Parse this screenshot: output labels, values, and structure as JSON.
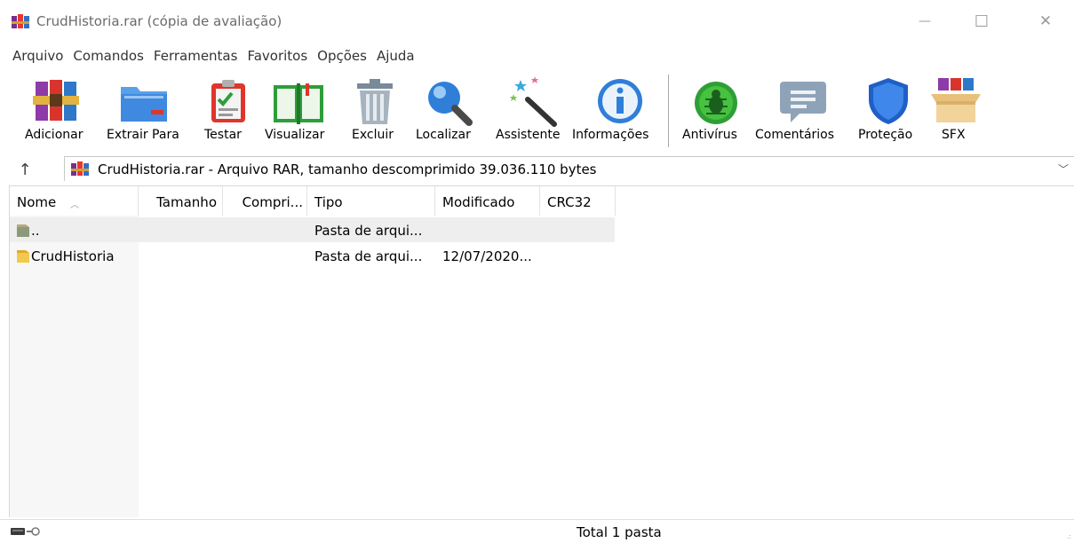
{
  "window": {
    "title": "CrudHistoria.rar (cópia de avaliação)",
    "minimize_glyph": "—",
    "maximize_glyph": "☐",
    "close_glyph": "✕"
  },
  "menu": [
    "Arquivo",
    "Comandos",
    "Ferramentas",
    "Favoritos",
    "Opções",
    "Ajuda"
  ],
  "toolbar": {
    "items": [
      {
        "label": "Adicionar",
        "icon": "books-add-icon"
      },
      {
        "label": "Extrair Para",
        "icon": "folder-extract-icon"
      },
      {
        "label": "Testar",
        "icon": "clipboard-check-icon"
      },
      {
        "label": "Visualizar",
        "icon": "open-book-icon"
      },
      {
        "label": "Excluir",
        "icon": "trash-icon"
      },
      {
        "label": "Localizar",
        "icon": "magnifier-icon"
      },
      {
        "label": "Assistente",
        "icon": "magic-wand-icon"
      },
      {
        "label": "Informações",
        "icon": "info-icon"
      },
      {
        "label": "Antivírus",
        "icon": "bug-icon"
      },
      {
        "label": "Comentários",
        "icon": "comment-icon"
      },
      {
        "label": "Proteção",
        "icon": "shield-icon"
      },
      {
        "label": "SFX",
        "icon": "sfx-box-icon"
      }
    ]
  },
  "address": {
    "up_glyph": "↑",
    "text": "CrudHistoria.rar - Arquivo RAR, tamanho descomprimido 39.036.110 bytes",
    "dropdown_glyph": "﹀"
  },
  "columns": [
    "Nome",
    "Tamanho",
    "Compri...",
    "Tipo",
    "Modificado",
    "CRC32"
  ],
  "rows": [
    {
      "name": "..",
      "size": "",
      "packed": "",
      "type": "Pasta de arqui...",
      "modified": "",
      "crc": ""
    },
    {
      "name": "CrudHistoria",
      "size": "",
      "packed": "",
      "type": "Pasta de arqui...",
      "modified": "12/07/2020...",
      "crc": ""
    }
  ],
  "status": {
    "text": "Total 1 pasta",
    "grip": ".:"
  },
  "colors": {
    "accent_blue": "#2e7fd6",
    "folder_yellow": "#f2c94c"
  }
}
